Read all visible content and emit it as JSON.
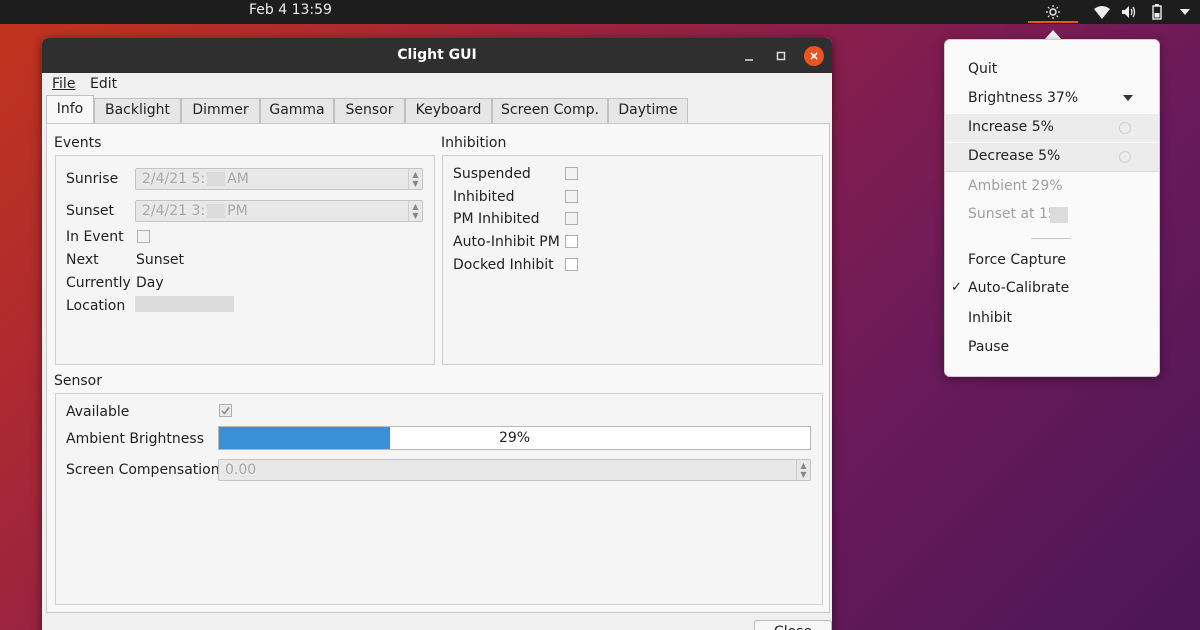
{
  "topbar": {
    "clock": "Feb 4  13:59",
    "icons": [
      "brightness-icon",
      "wifi-icon",
      "volume-icon",
      "battery-icon"
    ]
  },
  "window": {
    "title": "Clight GUI",
    "menu": [
      "File",
      "Edit"
    ],
    "tabs": [
      "Info",
      "Backlight",
      "Dimmer",
      "Gamma",
      "Sensor",
      "Keyboard",
      "Screen Comp.",
      "Daytime"
    ],
    "active_tab": "Info",
    "events": {
      "title": "Events",
      "sunrise_label": "Sunrise",
      "sunrise_value": "2/4/21 5:",
      "sunrise_suffix": "AM",
      "sunset_label": "Sunset",
      "sunset_value": "2/4/21 3:",
      "sunset_suffix": "PM",
      "in_event_label": "In Event",
      "next_label": "Next",
      "next_value": "Sunset",
      "currently_label": "Currently",
      "currently_value": "Day",
      "location_label": "Location"
    },
    "inhibition": {
      "title": "Inhibition",
      "items": [
        "Suspended",
        "Inhibited",
        "PM Inhibited",
        "Auto-Inhibit PM",
        "Docked Inhibit"
      ]
    },
    "sensor": {
      "title": "Sensor",
      "available_label": "Available",
      "available_checked": true,
      "ambient_label": "Ambient Brightness",
      "ambient_value": 0.29,
      "ambient_text": "29%",
      "screen_comp_label": "Screen Compensation",
      "screen_comp_value": "0.00"
    },
    "close_label": "Close"
  },
  "dropdown": {
    "quit": "Quit",
    "brightness": "Brightness 37%",
    "increase": "Increase 5%",
    "decrease": "Decrease 5%",
    "ambient": "Ambient 29%",
    "sunset": "Sunset at 15",
    "force_capture": "Force Capture",
    "auto_calibrate": "Auto-Calibrate",
    "auto_calibrate_check": "✓",
    "inhibit": "Inhibit",
    "pause": "Pause"
  },
  "colors": {
    "accent": "#e95420",
    "progress": "#3b8fd9",
    "titlebar": "#2f2f2f"
  }
}
